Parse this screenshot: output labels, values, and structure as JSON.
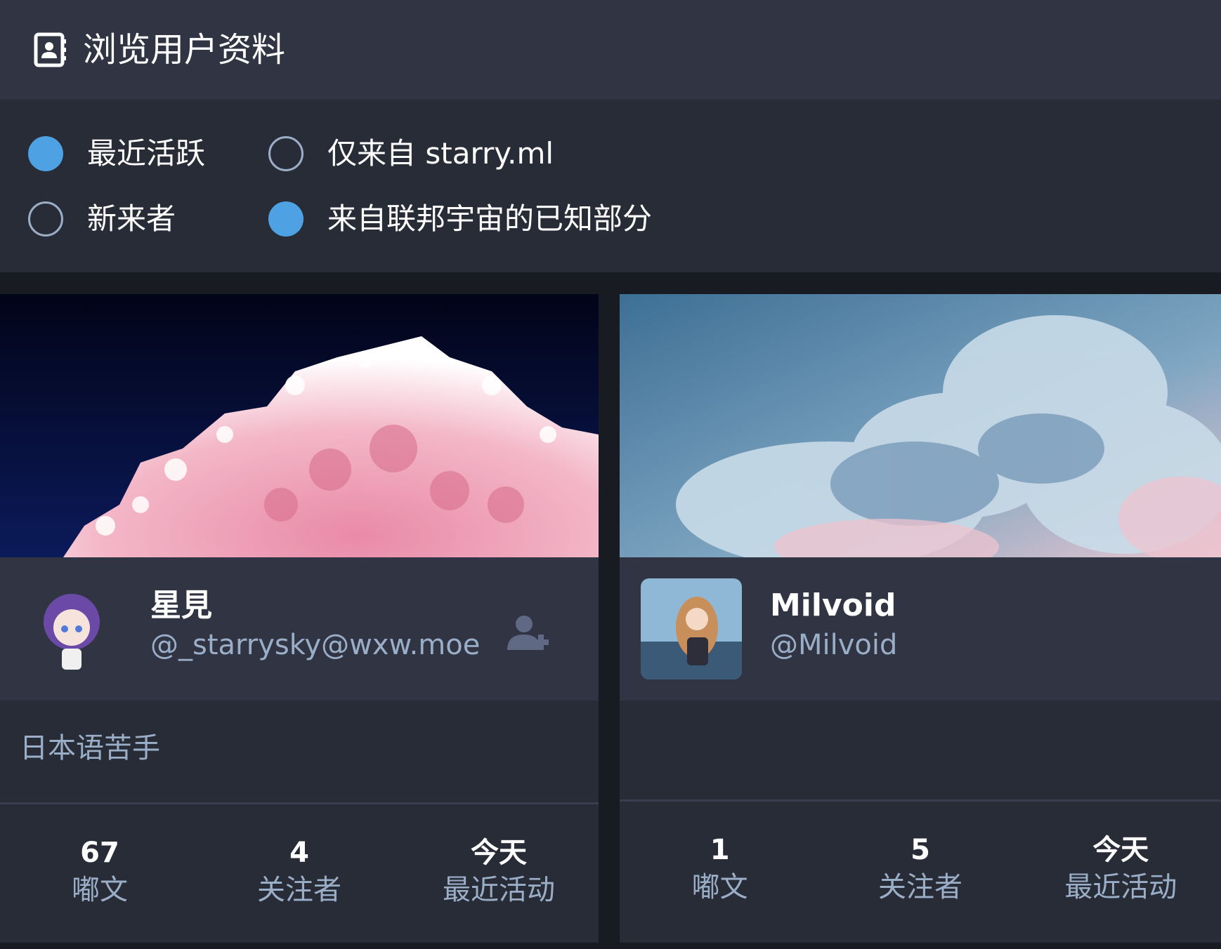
{
  "header": {
    "title": "浏览用户资料",
    "icon": "address-book-icon"
  },
  "filters": {
    "order": [
      {
        "label": "最近活跃",
        "checked": true
      },
      {
        "label": "新来者",
        "checked": false
      }
    ],
    "scope": [
      {
        "label": "仅来自 starry.ml",
        "checked": false
      },
      {
        "label": "来自联邦宇宙的已知部分",
        "checked": true
      }
    ]
  },
  "cards": [
    {
      "display_name": "星見",
      "acct": "@_starrysky@wxw.moe",
      "note": "日本语苦手",
      "follow_icon": "user-plus-icon",
      "stats": [
        {
          "value": "67",
          "label": "嘟文"
        },
        {
          "value": "4",
          "label": "关注者"
        },
        {
          "value": "今天",
          "label": "最近活动"
        }
      ]
    },
    {
      "display_name": "Milvoid",
      "acct": "@Milvoid",
      "note": "",
      "stats": [
        {
          "value": "1",
          "label": "嘟文"
        },
        {
          "value": "5",
          "label": "关注者"
        },
        {
          "value": "今天",
          "label": "最近活动"
        }
      ]
    }
  ],
  "colors": {
    "accent": "#4ea2e4",
    "header_bg": "#313543",
    "panel_bg": "#282c37",
    "page_bg": "#191b22",
    "muted_text": "#9baec8"
  }
}
